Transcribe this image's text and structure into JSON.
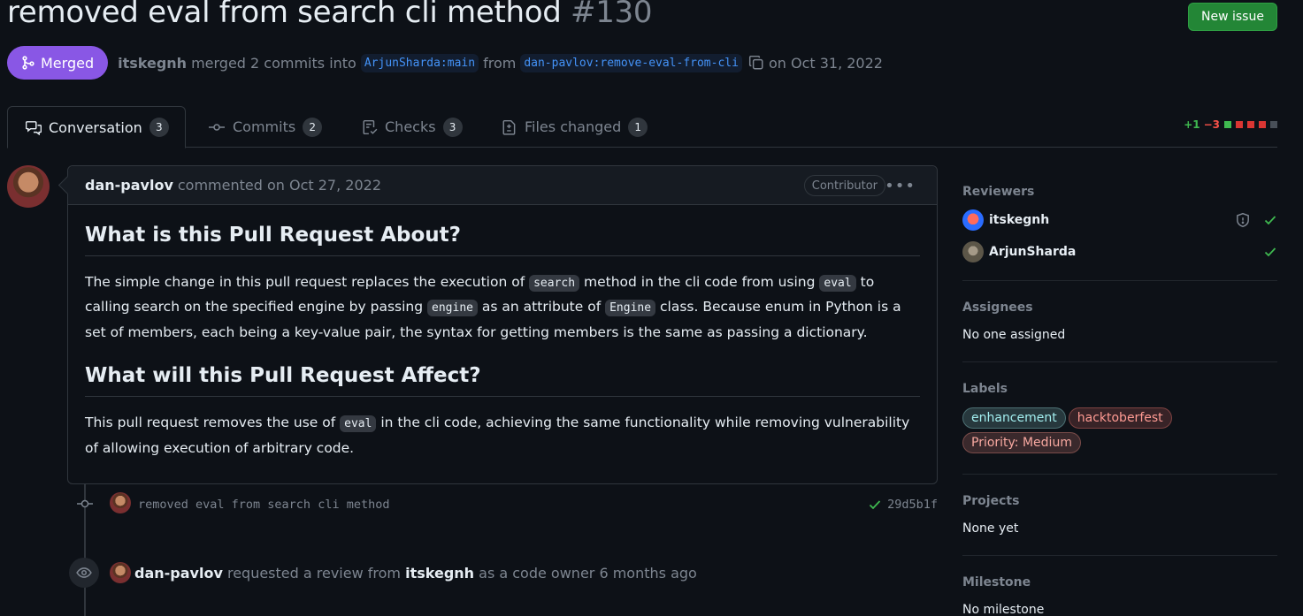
{
  "header": {
    "title": "removed eval from search cli method",
    "number": "#130",
    "new_issue_label": "New issue"
  },
  "state": {
    "badge_label": "Merged",
    "merger": "itskegnh",
    "merged_text": "merged 2 commits into",
    "base_branch": "ArjunSharda:main",
    "from_text": "from",
    "head_branch": "dan-pavlov:remove-eval-from-cli",
    "date_text": "on Oct 31, 2022"
  },
  "tabs": [
    {
      "label": "Conversation",
      "count": "3",
      "icon": "comment-discussion-icon"
    },
    {
      "label": "Commits",
      "count": "2",
      "icon": "git-commit-icon"
    },
    {
      "label": "Checks",
      "count": "3",
      "icon": "checklist-icon"
    },
    {
      "label": "Files changed",
      "count": "1",
      "icon": "file-diff-icon"
    }
  ],
  "diffstat": {
    "additions": "+1",
    "deletions": "−3"
  },
  "comment": {
    "author": "dan-pavlov",
    "meta": "commented on Oct 27, 2022",
    "role_badge": "Contributor",
    "h1": "What is this Pull Request About?",
    "p1_a": "The simple change in this pull request replaces the execution of",
    "p1_code1": "search",
    "p1_b": "method in the cli code from using",
    "p1_code2": "eval",
    "p1_c": "to calling search on the specified engine by passing",
    "p1_code3": "engine",
    "p1_d": "as an attribute of",
    "p1_code4": "Engine",
    "p1_e": "class. Because enum in Python is a set of members, each being a key-value pair, the syntax for getting members is the same as passing a dictionary.",
    "h2": "What will this Pull Request Affect?",
    "p2_a": "This pull request removes the use of",
    "p2_code": "eval",
    "p2_b": "in the cli code, achieving the same functionality while removing vulnerability of allowing execution of arbitrary code."
  },
  "commit": {
    "message": "removed eval from search cli method",
    "sha": "29d5b1f"
  },
  "review_event": {
    "actor": "dan-pavlov",
    "text_a": "requested a review from",
    "reviewer": "itskegnh",
    "text_b": "as a code owner 6 months ago"
  },
  "sidebar": {
    "reviewers_heading": "Reviewers",
    "reviewers": [
      {
        "name": "itskegnh"
      },
      {
        "name": "ArjunSharda"
      }
    ],
    "assignees_heading": "Assignees",
    "assignees_value": "No one assigned",
    "labels_heading": "Labels",
    "labels": [
      {
        "name": "enhancement",
        "color": "#a2eeef"
      },
      {
        "name": "hacktoberfest",
        "color": "#ff7b72"
      },
      {
        "name": "Priority: Medium",
        "color": "#f28b82"
      }
    ],
    "projects_heading": "Projects",
    "projects_value": "None yet",
    "milestone_heading": "Milestone",
    "milestone_value": "No milestone"
  },
  "colors": {
    "background": "#0d1117",
    "merged": "#8957e5",
    "link": "#4493f8",
    "success": "#3fb950",
    "danger": "#f85149"
  }
}
